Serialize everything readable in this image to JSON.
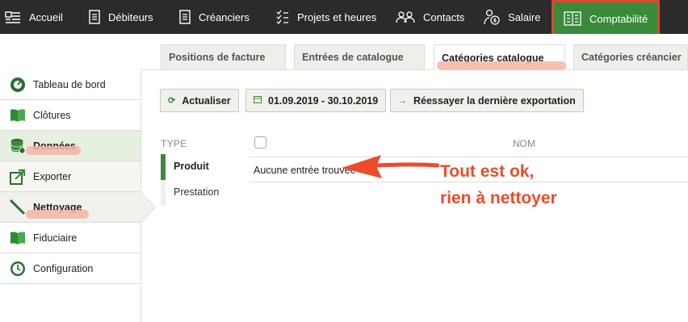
{
  "topnav": {
    "items": [
      {
        "label": "Accueil",
        "icon": "home-icon"
      },
      {
        "label": "Débiteurs",
        "icon": "document-icon"
      },
      {
        "label": "Créanciers",
        "icon": "document-icon"
      },
      {
        "label": "Projets et heures",
        "icon": "checklist-icon"
      },
      {
        "label": "Contacts",
        "icon": "contacts-icon"
      },
      {
        "label": "Salaire",
        "icon": "salary-icon"
      },
      {
        "label": "Comptabilité",
        "icon": "ledger-icon",
        "active": true
      }
    ]
  },
  "tabs": [
    {
      "label": "Positions de facture"
    },
    {
      "label": "Entrées de catalogue"
    },
    {
      "label": "Catégories catalogue",
      "active": true
    },
    {
      "label": "Catégories créancier"
    }
  ],
  "sidebar": {
    "items": [
      {
        "label": "Tableau de bord",
        "icon": "gauge-icon"
      },
      {
        "label": "Clôtures",
        "icon": "book-icon"
      },
      {
        "label": "Données",
        "icon": "database-icon"
      },
      {
        "label": "Exporter",
        "icon": "export-icon"
      },
      {
        "label": "Nettoyage",
        "icon": "broom-icon",
        "active": true
      },
      {
        "label": "Fiduciaire",
        "icon": "book-icon"
      },
      {
        "label": "Configuration",
        "icon": "clock-icon"
      }
    ]
  },
  "toolbar": {
    "refresh_label": "Actualiser",
    "daterange_label": "01.09.2019 - 30.10.2019",
    "retry_label": "Réessayer la dernière exportation"
  },
  "type_filter": {
    "header": "TYPE",
    "options": [
      {
        "label": "Produit",
        "active": true
      },
      {
        "label": "Prestation"
      }
    ]
  },
  "table": {
    "column_name": "NOM",
    "empty_text": "Aucune entrée trouvée"
  },
  "annotation": {
    "line1": "Tout est ok,",
    "line2": "rien à nettoyer"
  },
  "colors": {
    "nav_bg": "#2b2b2b",
    "accent_green": "#3a8a3c",
    "annotation_red": "#ee4b2b",
    "highlight_salmon": "#f3b5a4"
  }
}
